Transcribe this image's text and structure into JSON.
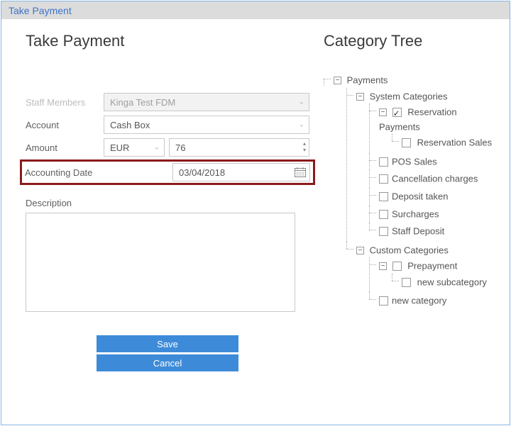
{
  "window": {
    "title": "Take Payment"
  },
  "form": {
    "heading": "Take Payment",
    "staff_label": "Staff Members",
    "staff_value": "Kinga Test FDM",
    "account_label": "Account",
    "account_value": "Cash Box",
    "amount_label": "Amount",
    "currency_value": "EUR",
    "amount_value": "76",
    "date_label": "Accounting Date",
    "date_value": "03/04/2018",
    "description_label": "Description",
    "save_label": "Save",
    "cancel_label": "Cancel"
  },
  "tree": {
    "heading": "Category Tree",
    "root": "Payments",
    "system": {
      "label": "System Categories",
      "items": [
        {
          "label": "Reservation Payments",
          "checked": true,
          "children": [
            {
              "label": "Reservation Sales",
              "checked": false
            }
          ]
        },
        {
          "label": "POS Sales",
          "checked": false
        },
        {
          "label": "Cancellation charges",
          "checked": false
        },
        {
          "label": "Deposit taken",
          "checked": false
        },
        {
          "label": "Surcharges",
          "checked": false
        },
        {
          "label": "Staff Deposit",
          "checked": false
        }
      ]
    },
    "custom": {
      "label": "Custom Categories",
      "items": [
        {
          "label": "Prepayment",
          "checked": false,
          "children": [
            {
              "label": "new subcategory",
              "checked": false
            }
          ]
        },
        {
          "label": "new category",
          "checked": false
        }
      ]
    }
  }
}
